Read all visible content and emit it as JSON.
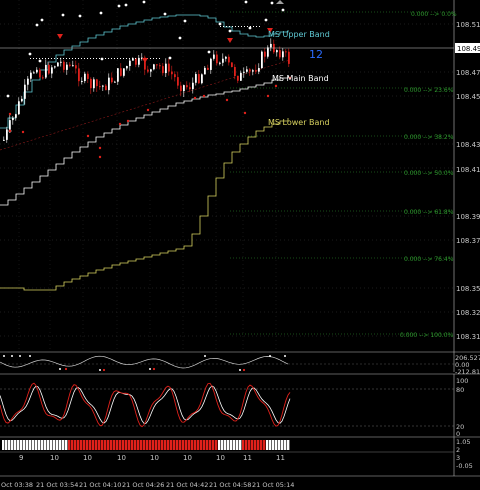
{
  "price_axis": {
    "labels": [
      "108.515",
      "108.490",
      "108.470",
      "108.450",
      "108.430",
      "108.410",
      "108.390",
      "108.370",
      "108.350",
      "108.325",
      "108.310"
    ],
    "current_price": "108.490"
  },
  "fib_levels": [
    {
      "label": "0.000 --> 0.0%"
    },
    {
      "label": "0.000 --> 23.6%"
    },
    {
      "label": "0.000 --> 38.2%"
    },
    {
      "label": "0.000 --> 50.0%"
    },
    {
      "label": "0.000 --> 61.8%"
    },
    {
      "label": "0.000 --> 76.4%"
    },
    {
      "label": "0.000 --> 100.0%"
    }
  ],
  "bands": {
    "upper": {
      "label": "MS Upper Band",
      "color": "#5fc9d4"
    },
    "main": {
      "label": "MS Main Band",
      "color": "#ffffff"
    },
    "lower": {
      "label": "MS Lower Band",
      "color": "#d8d260"
    }
  },
  "bar_counter": "12",
  "indicator1": {
    "top": "206.5275",
    "mid": "0.00",
    "bottom": "-212.818"
  },
  "indicator2": {
    "top": "100",
    "upper": "80",
    "lower": "20",
    "bottom": "0"
  },
  "indicator3": {
    "a": "1.05",
    "b": "2",
    "c": "3",
    "d": "-0.05"
  },
  "date_numbers": [
    "9",
    "10",
    "10",
    "10",
    "10",
    "10",
    "10",
    "11",
    "11"
  ],
  "time_labels": [
    "Oct 03:38",
    "21 Oct 03:54",
    "21 Oct 04:10",
    "21 Oct 04:26",
    "21 Oct 04:42",
    "21 Oct 04:58",
    "21 Oct 05:14"
  ],
  "colors": {
    "bull_candle": "#ffffff",
    "bear_candle": "#e0211b",
    "fib_line": "#2f9a2f",
    "grid": "#3a3a3a",
    "stoch_k": "#e0211b",
    "stoch_d": "#ffffff"
  }
}
